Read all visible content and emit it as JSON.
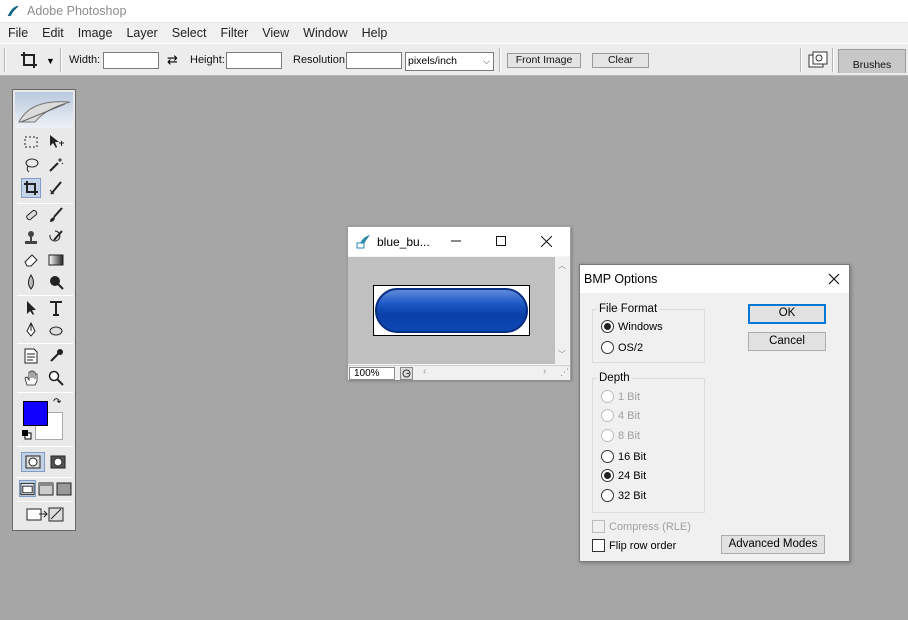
{
  "titlebar": {
    "title": "Adobe Photoshop"
  },
  "menu": [
    "File",
    "Edit",
    "Image",
    "Layer",
    "Select",
    "Filter",
    "View",
    "Window",
    "Help"
  ],
  "options": {
    "width_label": "Width:",
    "width_value": "",
    "height_label": "Height:",
    "height_value": "",
    "resolution_label": "Resolution:",
    "resolution_value": "",
    "units": "pixels/inch",
    "front_image": "Front Image",
    "clear": "Clear",
    "brushes_tab": "Brushes"
  },
  "toolbox": {
    "foreground_color": "#1000ff",
    "background_color": "#ffffff",
    "tools": [
      "marquee-icon",
      "move-icon",
      "lasso-icon",
      "magic-wand-icon",
      "crop-icon",
      "slice-icon",
      "healing-brush-icon",
      "brush-icon",
      "clone-stamp-icon",
      "history-brush-icon",
      "eraser-icon",
      "gradient-icon",
      "blur-icon",
      "dodge-icon",
      "path-select-icon",
      "type-icon",
      "pen-icon",
      "shape-icon",
      "notes-icon",
      "eyedropper-icon",
      "hand-icon",
      "zoom-icon"
    ]
  },
  "document": {
    "title": "blue_bu...",
    "zoom": "100%"
  },
  "bmp_dialog": {
    "title": "BMP Options",
    "file_format_label": "File Format",
    "file_formats": [
      {
        "label": "Windows",
        "checked": true,
        "disabled": false
      },
      {
        "label": "OS/2",
        "checked": false,
        "disabled": false
      }
    ],
    "depth_label": "Depth",
    "depths": [
      {
        "label": "1 Bit",
        "checked": false,
        "disabled": true
      },
      {
        "label": "4 Bit",
        "checked": false,
        "disabled": true
      },
      {
        "label": "8 Bit",
        "checked": false,
        "disabled": true
      },
      {
        "label": "16 Bit",
        "checked": false,
        "disabled": false
      },
      {
        "label": "24 Bit",
        "checked": true,
        "disabled": false
      },
      {
        "label": "32 Bit",
        "checked": false,
        "disabled": false
      }
    ],
    "compress_label": "Compress (RLE)",
    "flip_label": "Flip row order",
    "ok": "OK",
    "cancel": "Cancel",
    "advanced": "Advanced Modes"
  }
}
